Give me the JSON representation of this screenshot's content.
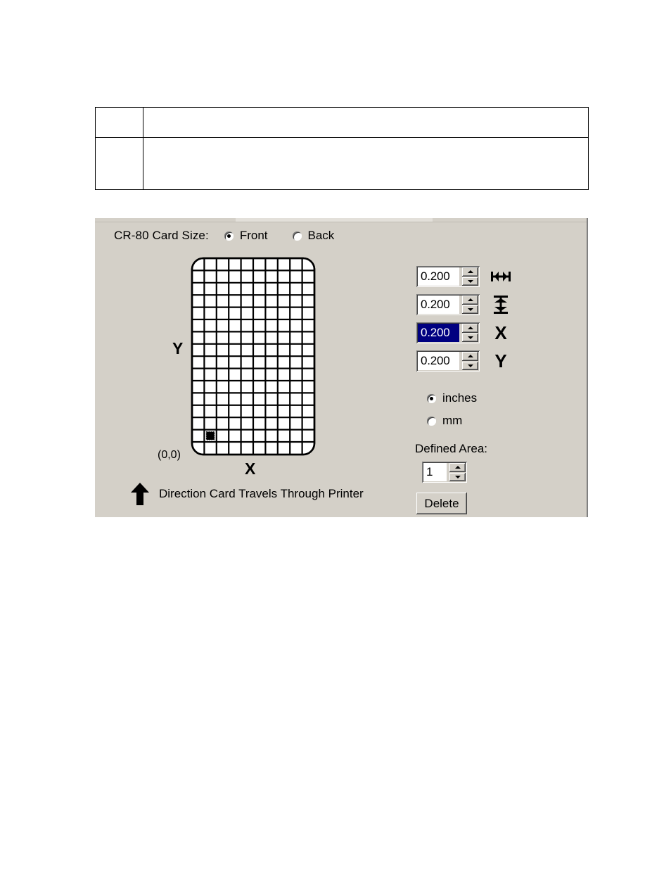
{
  "document": {
    "table": {
      "rows": [
        {
          "narrow_cell": "",
          "wide_cell": ""
        },
        {
          "narrow_cell": "",
          "wide_cell": ""
        }
      ]
    }
  },
  "dialog": {
    "card_size_label": "CR-80 Card Size:",
    "side_options": [
      {
        "label": "Front",
        "selected": true
      },
      {
        "label": "Back",
        "selected": false
      }
    ],
    "card_preview": {
      "y_axis_label": "Y",
      "x_axis_label": "X",
      "origin_label": "(0,0)",
      "grid_columns": 10,
      "grid_rows": 16,
      "selected_cell": {
        "column": 2,
        "row": 15
      }
    },
    "direction": {
      "arrow_icon": "up-arrow-icon",
      "text": "Direction Card Travels Through Printer"
    },
    "dimension_fields": [
      {
        "name": "width",
        "value": "0.200",
        "icon": "horizontal-width-icon",
        "icon_label": "",
        "selected": false
      },
      {
        "name": "height",
        "value": "0.200",
        "icon": "vertical-height-icon",
        "icon_label": "",
        "selected": false
      },
      {
        "name": "x-position",
        "value": "0.200",
        "icon": "x-letter-icon",
        "icon_label": "X",
        "selected": true
      },
      {
        "name": "y-position",
        "value": "0.200",
        "icon": "y-letter-icon",
        "icon_label": "Y",
        "selected": false
      }
    ],
    "units": [
      {
        "label": "inches",
        "selected": true
      },
      {
        "label": "mm",
        "selected": false
      }
    ],
    "defined_area": {
      "label": "Defined Area:",
      "value": "1"
    },
    "delete_label": "Delete"
  },
  "colors": {
    "panel_bg": "#d4d0c8",
    "selection_bg": "#000080",
    "selection_fg": "#ffffff",
    "text": "#000000",
    "field_bg": "#ffffff"
  }
}
